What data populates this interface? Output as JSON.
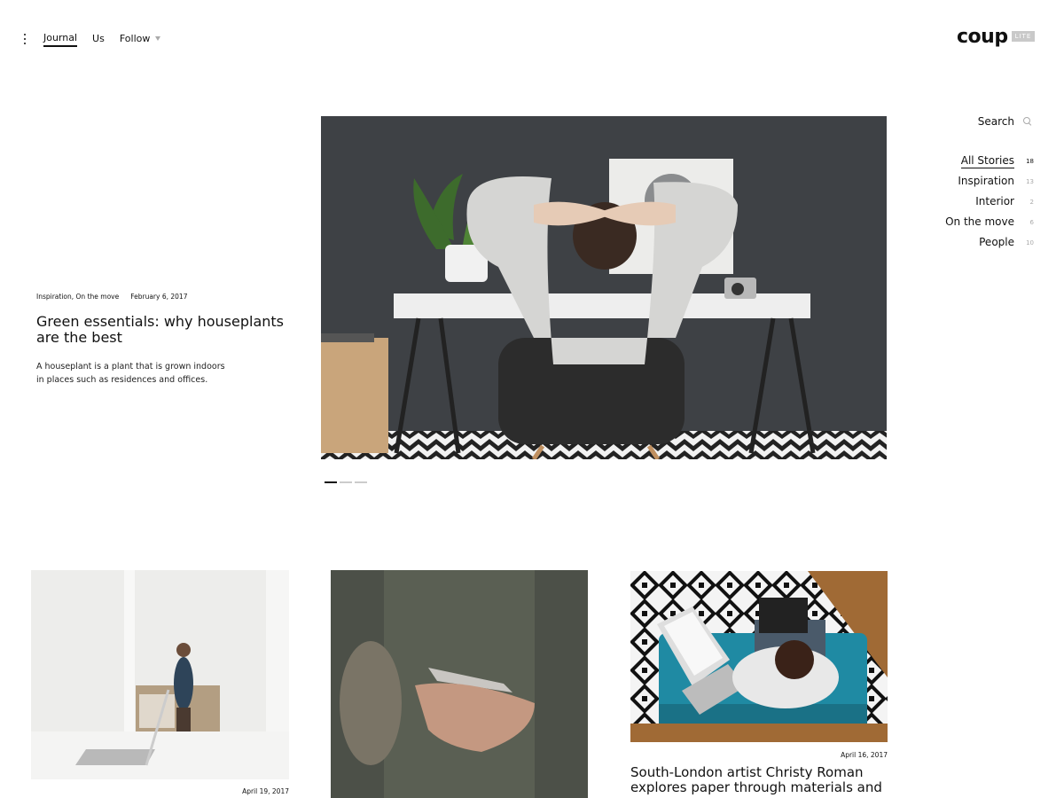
{
  "header": {
    "nav": [
      {
        "label": "Journal",
        "active": true
      },
      {
        "label": "Us",
        "active": false
      },
      {
        "label": "Follow",
        "active": false
      }
    ],
    "logo": {
      "word": "coup",
      "badge": "LITE"
    }
  },
  "sidebar": {
    "search_label": "Search",
    "categories": [
      {
        "label": "All Stories",
        "count": "18",
        "active": true
      },
      {
        "label": "Inspiration",
        "count": "13"
      },
      {
        "label": "Interior",
        "count": "2"
      },
      {
        "label": "On the move",
        "count": "6"
      },
      {
        "label": "People",
        "count": "10"
      }
    ]
  },
  "featured": {
    "categories": "Inspiration, On the move",
    "date": "February 6, 2017",
    "title": "Green essentials: why houseplants are the best",
    "excerpt_line1": "A houseplant is a plant that is grown indoors",
    "excerpt_line2": "in places such as residences and offices.",
    "slider_active_index": 0,
    "slider_count": 3
  },
  "grid": [
    {
      "date": "April 19, 2017",
      "title": ""
    },
    {
      "date": "",
      "title": ""
    },
    {
      "date": "April 16, 2017",
      "title": "South-London artist Christy Roman explores paper through materials and"
    }
  ]
}
